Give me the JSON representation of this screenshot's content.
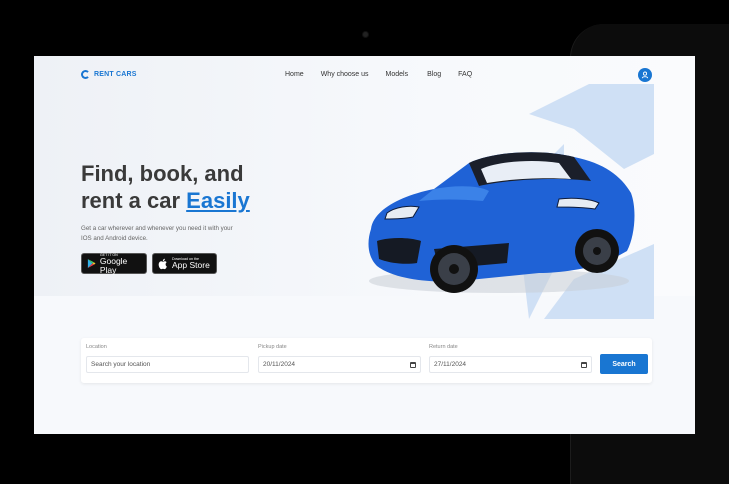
{
  "brand": {
    "name": "RENT CARS",
    "accent_color": "#1976d2"
  },
  "nav": {
    "items": [
      "Home",
      "Why choose us",
      "Models",
      "Blog",
      "FAQ"
    ],
    "profile_icon": "user-icon"
  },
  "hero": {
    "title_line1": "Find, book, and",
    "title_line2_prefix": "rent a car ",
    "title_highlight": "Easily",
    "subtitle": "Get a car wherever and whenever you need it with your IOS and Android device.",
    "image": "blue-sports-car"
  },
  "stores": {
    "google_small": "GET IT ON",
    "google_big": "Google Play",
    "apple_small": "Download on the",
    "apple_big": "App Store"
  },
  "search": {
    "location_label": "Location",
    "location_placeholder": "Search your location",
    "pickup_label": "Pickup date",
    "pickup_value": "20/11/2024",
    "return_label": "Return date",
    "return_value": "27/11/2024",
    "button_label": "Search"
  }
}
